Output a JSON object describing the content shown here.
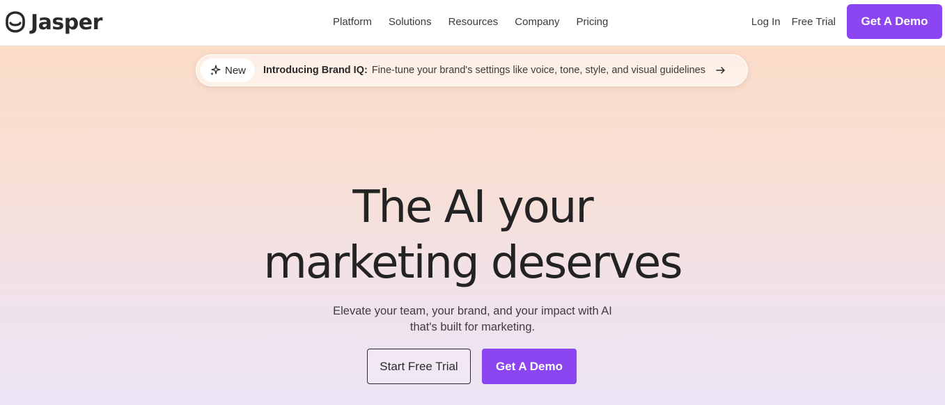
{
  "brand": {
    "name": "Jasper",
    "accent_color": "#8b46f2",
    "logo_icon": "jasper-face-icon"
  },
  "nav": {
    "items": [
      {
        "label": "Platform"
      },
      {
        "label": "Solutions"
      },
      {
        "label": "Resources"
      },
      {
        "label": "Company"
      },
      {
        "label": "Pricing"
      }
    ],
    "login_label": "Log In",
    "free_trial_label": "Free Trial",
    "demo_label": "Get A Demo"
  },
  "announcement": {
    "badge_icon": "sparkle-icon",
    "badge_label": "New",
    "title": "Introducing Brand IQ:",
    "text": "Fine-tune your brand's settings like voice, tone, style, and visual guidelines",
    "arrow_icon": "arrow-right-icon"
  },
  "hero": {
    "title_line1": "The AI your",
    "title_line2": "marketing deserves",
    "subtitle_line1": "Elevate your team, your brand, and your impact with AI",
    "subtitle_line2": "that's built for marketing.",
    "cta_secondary": "Start Free Trial",
    "cta_primary": "Get A Demo"
  }
}
